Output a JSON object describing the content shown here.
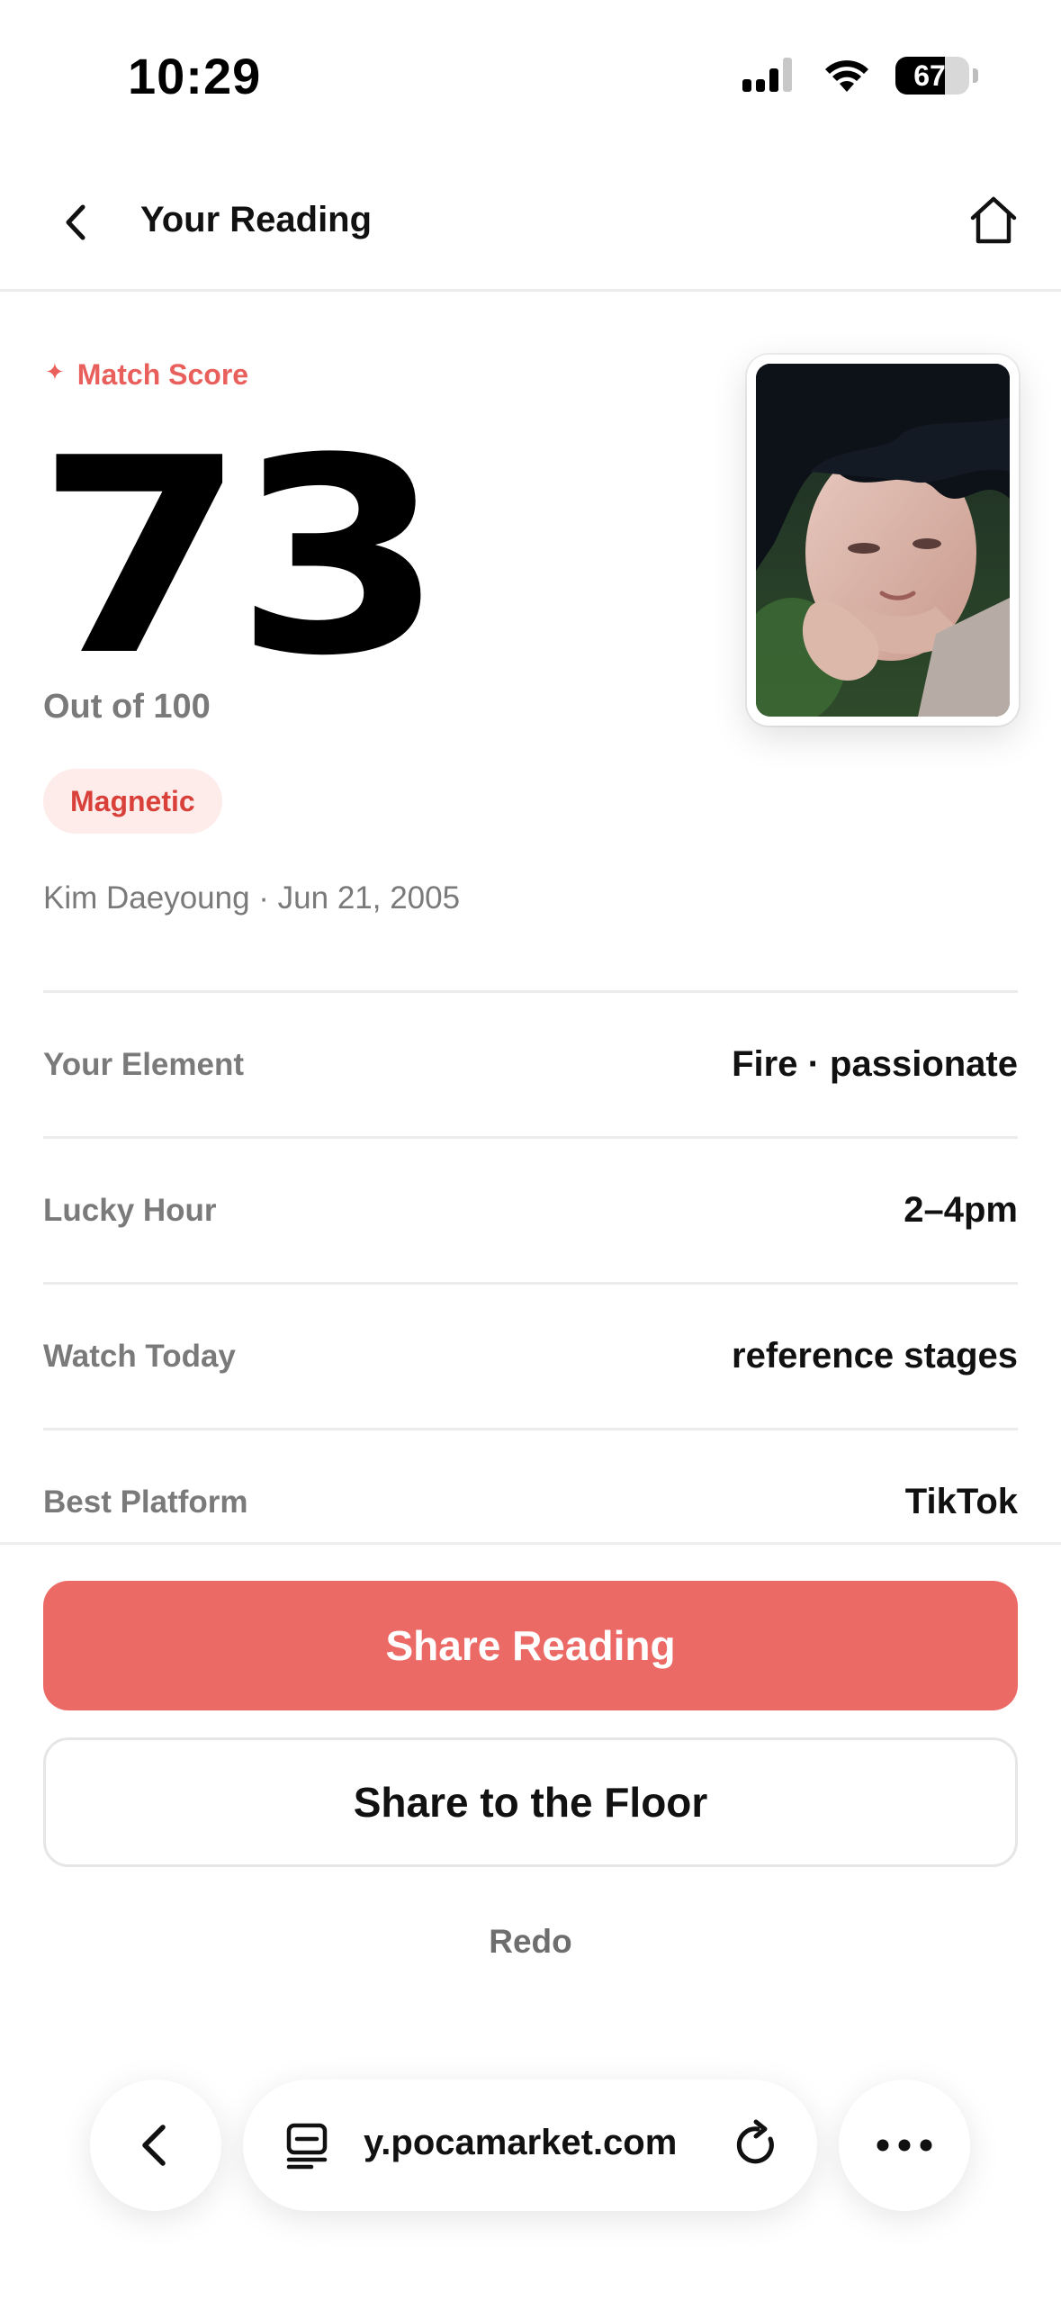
{
  "status_bar": {
    "time": "10:29",
    "battery_level": "67",
    "battery_fraction": 0.67
  },
  "header": {
    "title": "Your Reading",
    "back_icon": "chevron-left-icon",
    "home_icon": "home-icon"
  },
  "score_section": {
    "label": "Match Score",
    "label_icon": "sparkle-icon",
    "score": "73",
    "out_of": "Out of 100",
    "badge": "Magnetic",
    "meta": "Kim Daeyoung · Jun 21, 2005",
    "photo": "idol-photocard"
  },
  "details": [
    {
      "label": "Your Element",
      "value": "Fire · passionate"
    },
    {
      "label": "Lucky Hour",
      "value": "2–4pm"
    },
    {
      "label": "Watch Today",
      "value": "reference stages"
    },
    {
      "label": "Best Platform",
      "value": "TikTok"
    }
  ],
  "actions": {
    "share_reading": "Share Reading",
    "share_floor": "Share to the Floor",
    "redo": "Redo"
  },
  "browser_bar": {
    "url": "y.pocamarket.com",
    "back_icon": "chevron-left-icon",
    "tabs_icon": "tabs-icon",
    "reload_icon": "reload-icon",
    "more_icon": "more-horizontal-icon"
  },
  "colors": {
    "accent": "#ec6a66",
    "badge_bg": "#fdecea",
    "badge_text": "#d9403a",
    "muted_text": "#7a7a7a"
  }
}
